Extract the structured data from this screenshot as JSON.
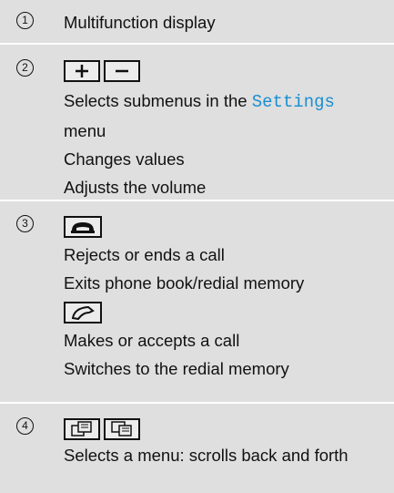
{
  "rows": [
    {
      "number": "1",
      "lines": [
        "Multifunction display"
      ]
    },
    {
      "number": "2",
      "buttons": [
        {
          "icon": "plus-icon"
        },
        {
          "icon": "minus-icon"
        }
      ],
      "line1_pre": "Selects submenus in the ",
      "line1_keyword": "Settings",
      "line1_post": "menu",
      "line2": "Changes values",
      "line3": "Adjusts the volume"
    },
    {
      "number": "3",
      "end_call_icon": "end-call-icon",
      "line1": "Rejects or ends a call",
      "line2": "Exits phone book/redial memory",
      "accept_call_icon": "accept-call-icon",
      "line3": "Makes or accepts a call",
      "line4": "Switches to the redial memory"
    },
    {
      "number": "4",
      "buttons": [
        {
          "icon": "page-back-icon"
        },
        {
          "icon": "page-forward-icon"
        }
      ],
      "line1": "Selects a menu: scrolls back and forth"
    }
  ],
  "colors": {
    "background": "#dfdfdf",
    "separator": "#ffffff",
    "keyword": "#1a8fd0"
  }
}
